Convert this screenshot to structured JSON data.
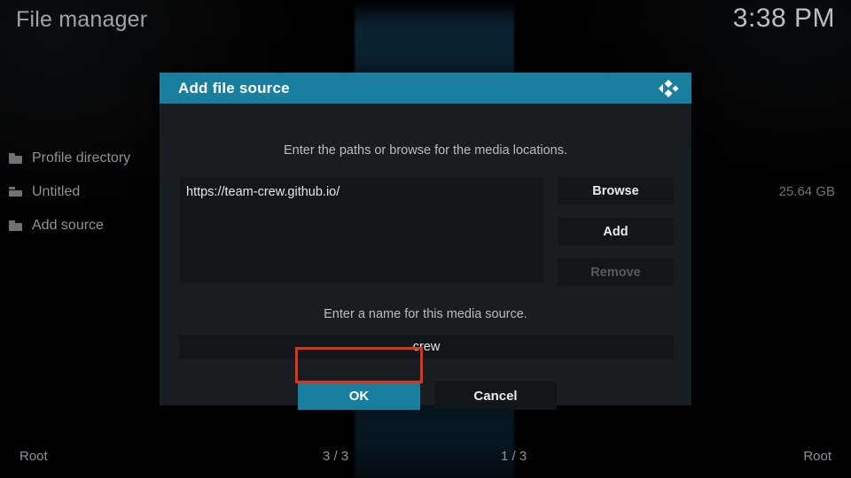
{
  "header": {
    "window_title": "File manager",
    "clock": "3:38 PM"
  },
  "sidebar": {
    "items": [
      {
        "label": "Profile directory",
        "icon": "folder-icon"
      },
      {
        "label": "Untitled",
        "icon": "folder-open-icon"
      },
      {
        "label": "Add source",
        "icon": "folder-icon"
      }
    ]
  },
  "right_panel": {
    "disk_size": "25.64 GB"
  },
  "dialog": {
    "title": "Add file source",
    "logo_icon": "kodi-logo-icon",
    "paths_hint": "Enter the paths or browse for the media locations.",
    "path_entries": [
      "https://team-crew.github.io/"
    ],
    "buttons": {
      "browse": "Browse",
      "add": "Add",
      "remove": "Remove",
      "ok": "OK",
      "cancel": "Cancel"
    },
    "name_hint": "Enter a name for this media source.",
    "name_value": "crew"
  },
  "status_bar": {
    "left": "Root",
    "count_left": "3 / 3",
    "count_right": "1 / 3",
    "right": "Root"
  },
  "colors": {
    "accent_teal": "#1a7f9e",
    "highlight_red": "#e03316",
    "dialog_bg": "#171d21",
    "input_bg": "#10161a"
  }
}
